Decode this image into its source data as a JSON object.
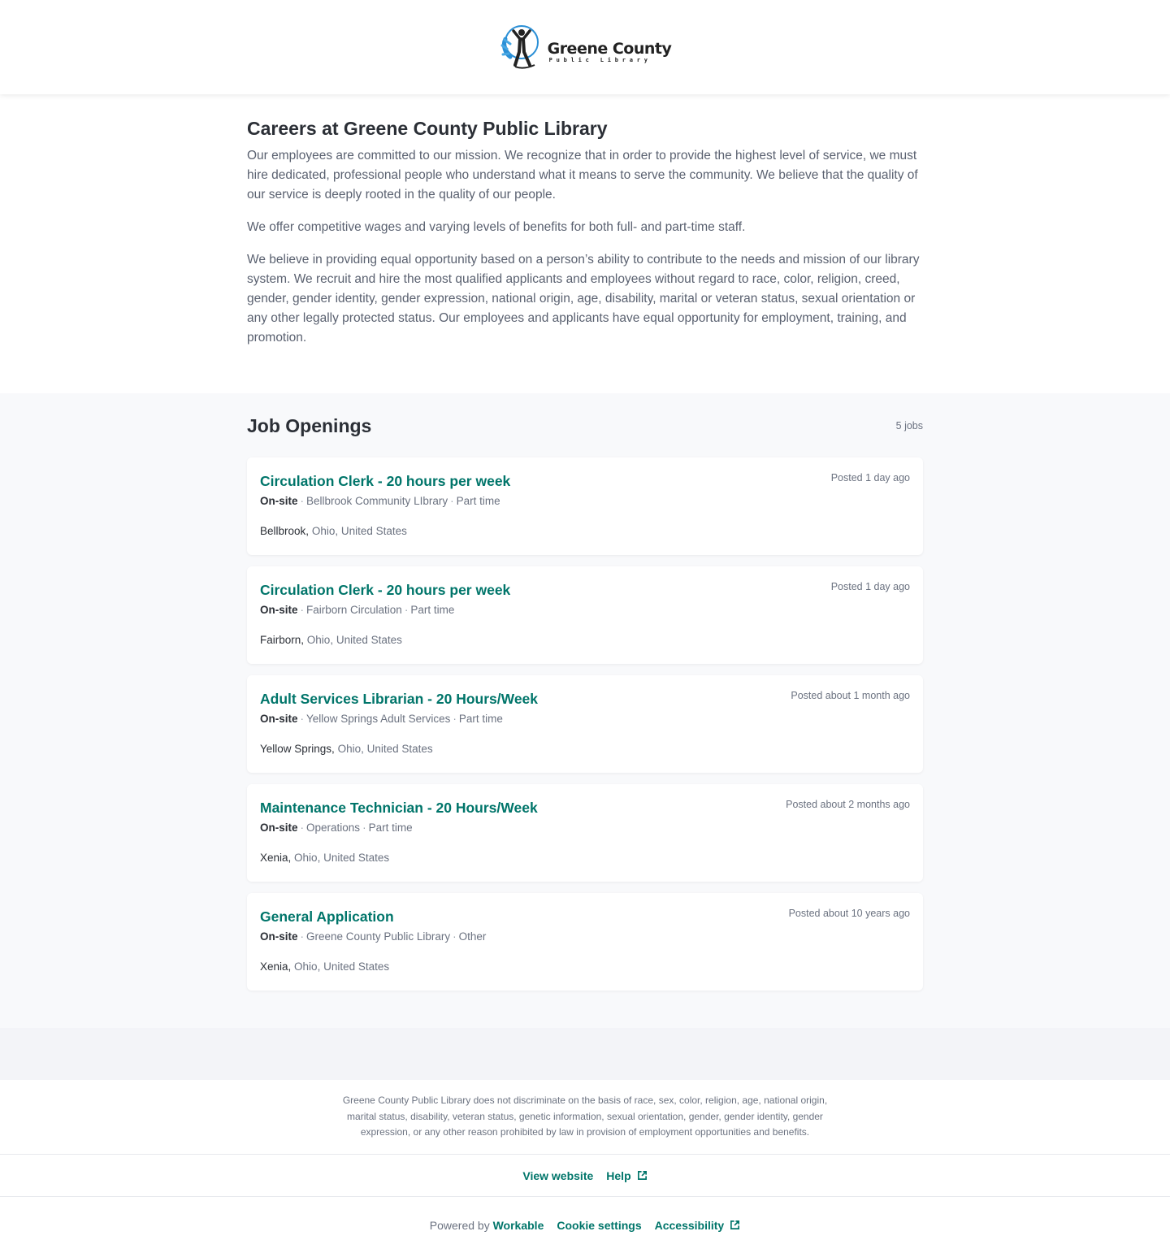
{
  "header": {
    "logo_name": "Greene County",
    "logo_sub": "Public Library"
  },
  "intro": {
    "title": "Careers at Greene County Public Library",
    "paragraphs": [
      "Our employees are committed to our mission. We recognize that in order to provide the highest level of service, we must hire dedicated, professional people who understand what it means to serve the community. We believe that the quality of our service is deeply rooted in the quality of our people.",
      "We offer competitive wages and varying levels of benefits for both full- and part-time staff.",
      "We believe in providing equal opportunity based on a person’s ability to contribute to the needs and mission of our library system. We recruit and hire the most qualified applicants and employees without regard to race, color, religion, creed, gender, gender identity, gender expression, national origin, age, disability, marital or veteran status, sexual orientation or any other legally protected status. Our employees and applicants have equal opportunity for employment, training, and promotion."
    ]
  },
  "jobs": {
    "heading": "Job Openings",
    "count": "5 jobs",
    "items": [
      {
        "title": "Circulation Clerk - 20 hours per week",
        "posted": "Posted 1 day ago",
        "workplace": "On-site",
        "department": "Bellbrook Community LIbrary",
        "type": "Part time",
        "city": "Bellbrook,",
        "region": "Ohio, United States"
      },
      {
        "title": "Circulation Clerk - 20 hours per week",
        "posted": "Posted 1 day ago",
        "workplace": "On-site",
        "department": "Fairborn Circulation",
        "type": "Part time",
        "city": "Fairborn,",
        "region": "Ohio, United States"
      },
      {
        "title": "Adult Services Librarian - 20 Hours/Week",
        "posted": "Posted about 1 month ago",
        "workplace": "On-site",
        "department": "Yellow Springs Adult Services",
        "type": "Part time",
        "city": "Yellow Springs,",
        "region": "Ohio, United States"
      },
      {
        "title": "Maintenance Technician - 20 Hours/Week",
        "posted": "Posted about 2 months ago",
        "workplace": "On-site",
        "department": "Operations",
        "type": "Part time",
        "city": "Xenia,",
        "region": "Ohio, United States"
      },
      {
        "title": "General Application",
        "posted": "Posted about 10 years ago",
        "workplace": "On-site",
        "department": "Greene County Public Library",
        "type": "Other",
        "city": "Xenia,",
        "region": "Ohio, United States"
      }
    ]
  },
  "footer": {
    "eeo_text": "Greene County Public Library does not discriminate on the basis of race, sex, color, religion, age, national origin, marital status, disability, veteran status, genetic information, sexual orientation, gender, gender identity, gender expression, or any other reason prohibited by law in provision of employment opportunities and benefits.",
    "view_website": "View website",
    "help": "Help",
    "powered_by_prefix": "Powered by",
    "powered_by_brand": "Workable",
    "cookie_settings": "Cookie settings",
    "accessibility": "Accessibility"
  },
  "colors": {
    "accent": "#00756a",
    "jobs_background": "#f8f9fb",
    "band_background": "#f3f4f8",
    "logo_blue": "#2a8fd6"
  },
  "icons": {
    "logo": "library-figure-logo",
    "external": "external-link-icon"
  }
}
